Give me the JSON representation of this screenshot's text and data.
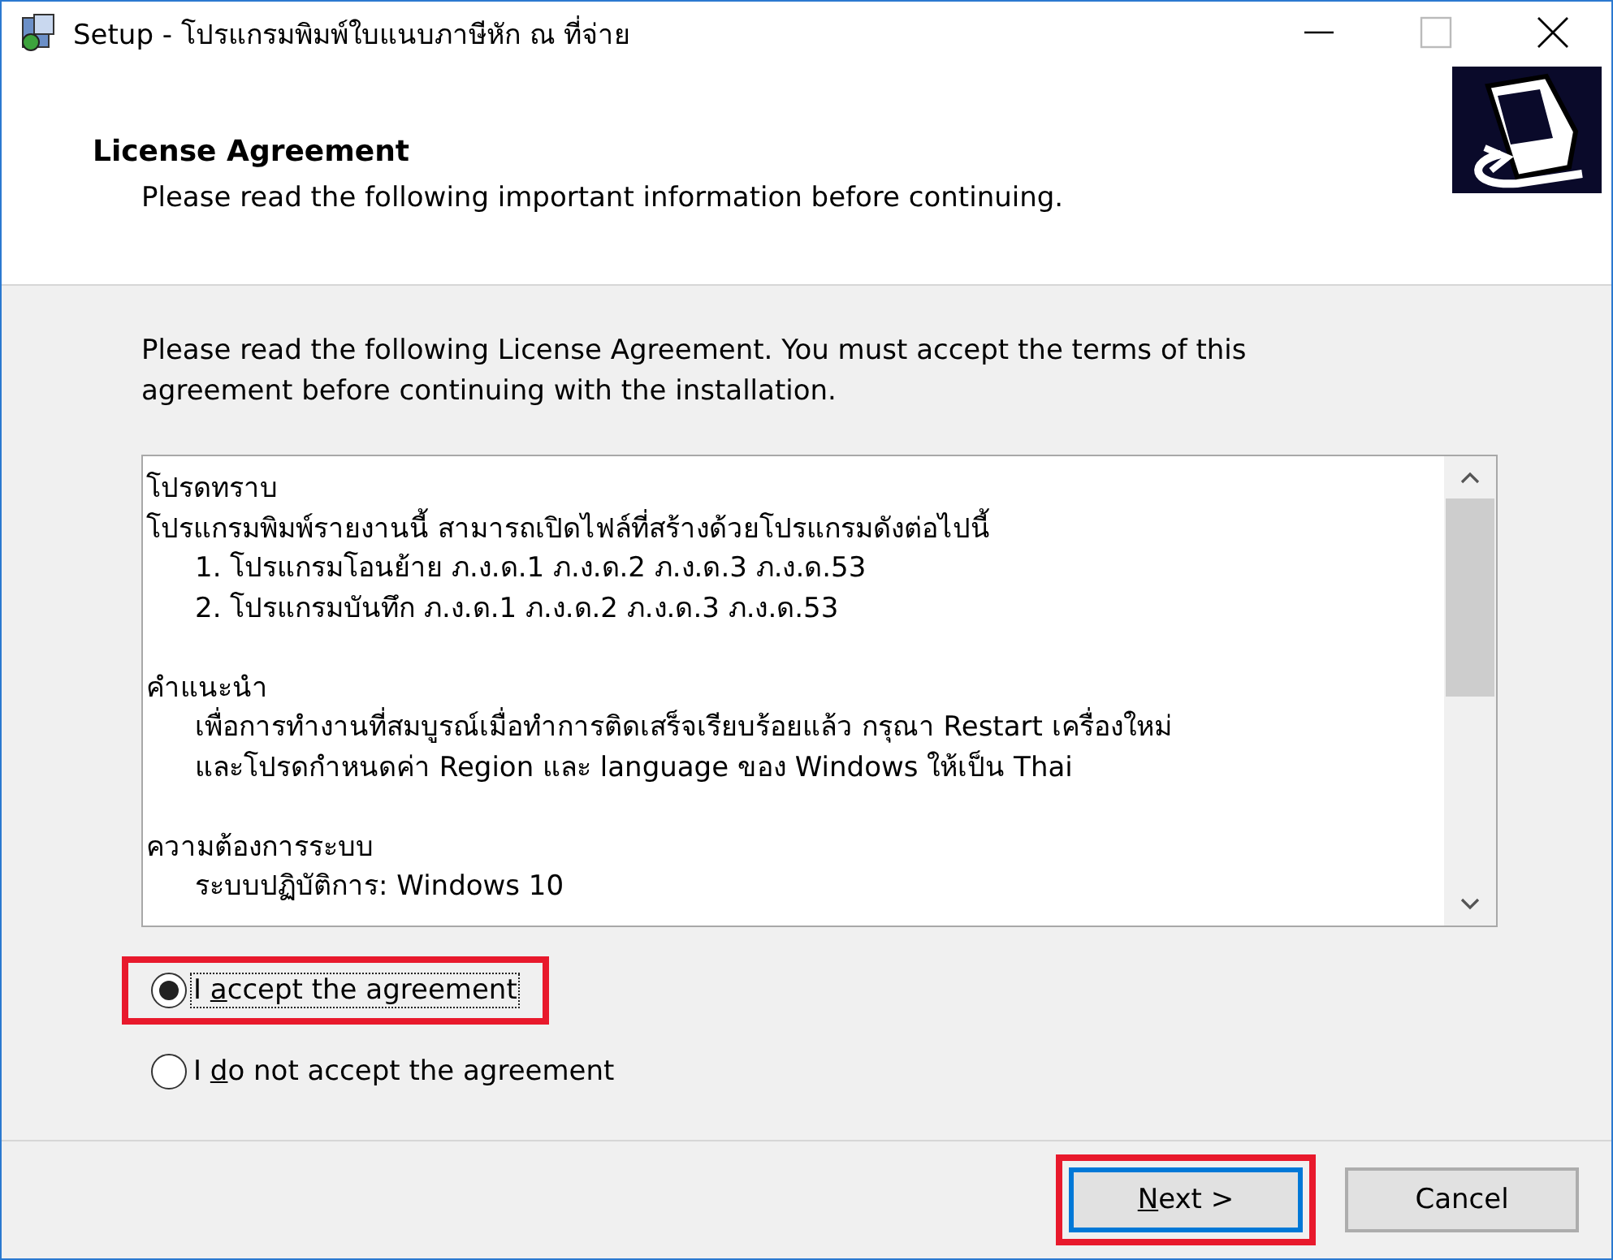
{
  "window": {
    "title": "Setup - โปรแกรมพิมพ์ใบแนบภาษีหัก ณ ที่จ่าย"
  },
  "header": {
    "title": "License Agreement",
    "subtitle": "Please read the following important information before continuing."
  },
  "intro": "Please read the following License Agreement. You must accept the terms of this agreement before continuing with the installation.",
  "license_text": [
    {
      "kind": "plain",
      "text": "โปรดทราบ"
    },
    {
      "kind": "plain",
      "text": "โปรแกรมพิมพ์รายงานนี้ สามารถเปิดไฟล์ที่สร้างด้วยโปรแกรมดังต่อไปนี้"
    },
    {
      "kind": "indented",
      "text": "1. โปรแกรมโอนย้าย ภ.ง.ด.1 ภ.ง.ด.2 ภ.ง.ด.3 ภ.ง.ด.53"
    },
    {
      "kind": "indented",
      "text": "2. โปรแกรมบันทึก ภ.ง.ด.1 ภ.ง.ด.2 ภ.ง.ด.3 ภ.ง.ด.53"
    },
    {
      "kind": "blank"
    },
    {
      "kind": "plain",
      "text": "คำแนะนำ"
    },
    {
      "kind": "indented",
      "text": "เพื่อการทำงานที่สมบูรณ์เมื่อทำการติดเสร็จเรียบร้อยแล้ว กรุณา Restart เครื่องใหม่"
    },
    {
      "kind": "indented",
      "text": "และโปรดกำหนดค่า Region และ language ของ Windows ให้เป็น Thai"
    },
    {
      "kind": "blank"
    },
    {
      "kind": "plain",
      "text": "ความต้องการระบบ"
    },
    {
      "kind": "indented",
      "text": "ระบบปฏิบัติการ: Windows 10"
    }
  ],
  "options": [
    {
      "label_before": "I ",
      "access_key": "a",
      "label_after": "ccept the agreement",
      "selected": true,
      "focused": true,
      "highlighted": true
    },
    {
      "label_before": "I ",
      "access_key": "d",
      "label_after": "o not accept the agreement",
      "selected": false,
      "focused": false,
      "highlighted": false
    }
  ],
  "buttons": [
    {
      "access_key": "N",
      "label_after": "ext >",
      "default": true,
      "highlighted": true
    },
    {
      "label_after": "Cancel",
      "default": false,
      "highlighted": false
    }
  ]
}
